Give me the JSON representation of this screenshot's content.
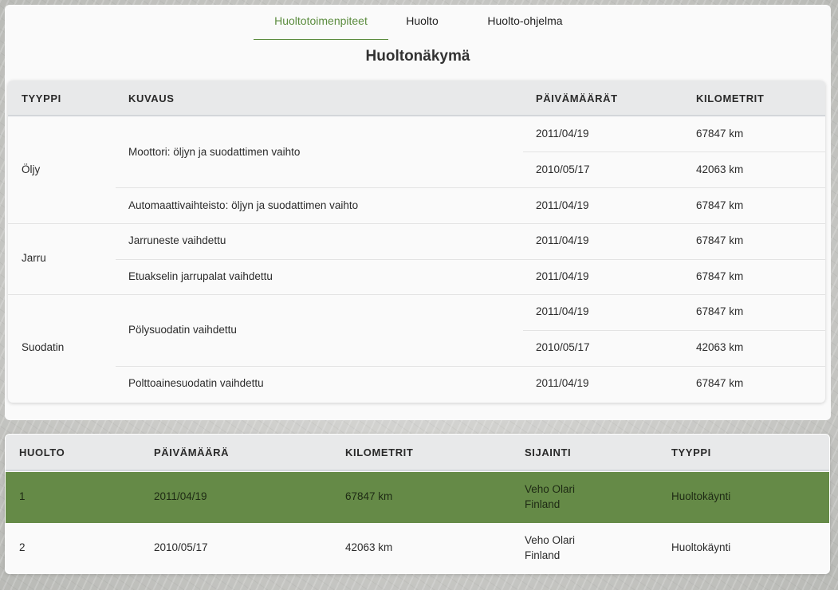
{
  "tabs": [
    {
      "label": "Huoltotoimenpiteet",
      "active": true
    },
    {
      "label": "Huolto",
      "active": false
    },
    {
      "label": "Huolto-ohjelma",
      "active": false
    }
  ],
  "title": "Huoltonäkymä",
  "maintenance_table": {
    "headers": [
      "TYYPPI",
      "KUVAUS",
      "PÄIVÄMÄÄRÄT",
      "KILOMETRIT"
    ],
    "groups": [
      {
        "type": "Öljy",
        "items": [
          {
            "description": "Moottori: öljyn ja suodattimen vaihto",
            "entries": [
              {
                "date": "2011/04/19",
                "km": "67847 km"
              },
              {
                "date": "2010/05/17",
                "km": "42063 km"
              }
            ]
          },
          {
            "description": "Automaattivaihteisto: öljyn ja suodattimen vaihto",
            "entries": [
              {
                "date": "2011/04/19",
                "km": "67847 km"
              }
            ]
          }
        ]
      },
      {
        "type": "Jarru",
        "items": [
          {
            "description": "Jarruneste vaihdettu",
            "entries": [
              {
                "date": "2011/04/19",
                "km": "67847 km"
              }
            ]
          },
          {
            "description": "Etuakselin jarrupalat vaihdettu",
            "entries": [
              {
                "date": "2011/04/19",
                "km": "67847 km"
              }
            ]
          }
        ]
      },
      {
        "type": "Suodatin",
        "items": [
          {
            "description": "Pölysuodatin vaihdettu",
            "entries": [
              {
                "date": "2011/04/19",
                "km": "67847 km"
              },
              {
                "date": "2010/05/17",
                "km": "42063 km"
              }
            ]
          },
          {
            "description": "Polttoainesuodatin vaihdettu",
            "entries": [
              {
                "date": "2011/04/19",
                "km": "67847 km"
              }
            ]
          }
        ]
      }
    ]
  },
  "services_table": {
    "headers": [
      "HUOLTO",
      "PÄIVÄMÄÄRÄ",
      "KILOMETRIT",
      "SIJAINTI",
      "TYYPPI"
    ],
    "rows": [
      {
        "id": "1",
        "date": "2011/04/19",
        "km": "67847 km",
        "location_line1": "Veho Olari",
        "location_line2": "Finland",
        "type": "Huoltokäynti",
        "selected": true
      },
      {
        "id": "2",
        "date": "2010/05/17",
        "km": "42063 km",
        "location_line1": "Veho Olari",
        "location_line2": "Finland",
        "type": "Huoltokäynti",
        "selected": false
      }
    ]
  },
  "colors": {
    "accent": "#5b8c3e",
    "selected_row": "#658a47",
    "header_bg": "#e8e9ea"
  }
}
